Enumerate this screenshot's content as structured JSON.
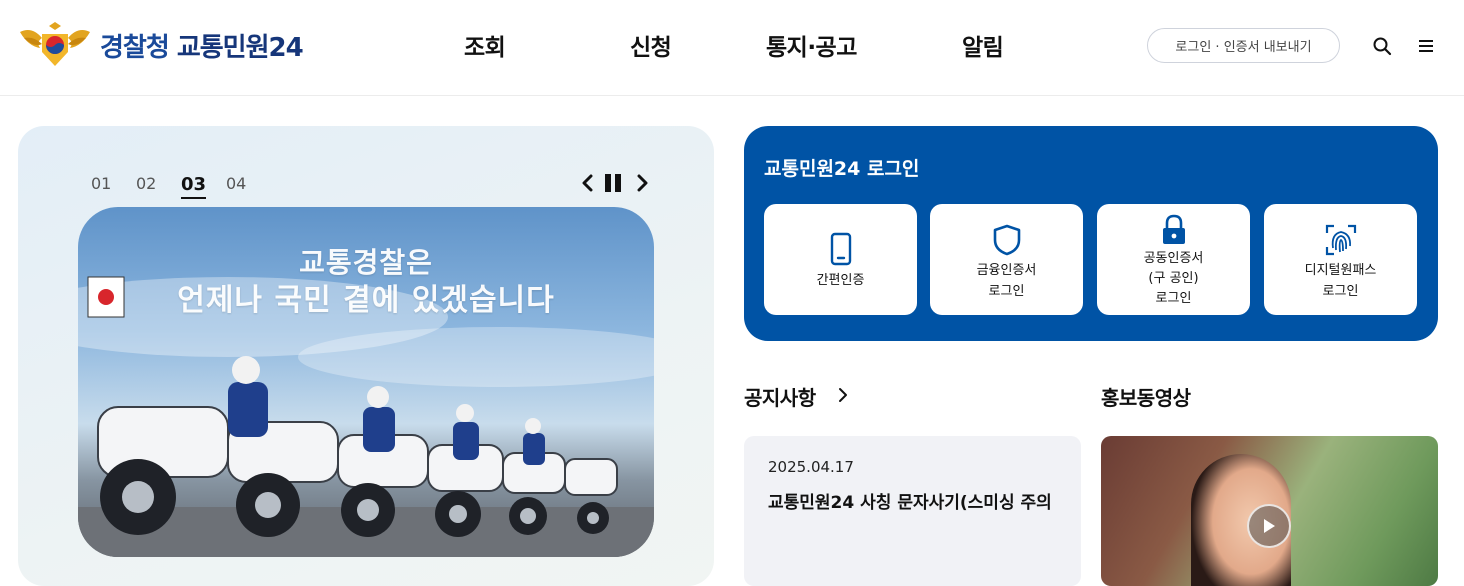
{
  "header": {
    "logo_text_1": "경찰청",
    "logo_text_2": "교통민원24",
    "nav": [
      "조회",
      "신청",
      "통지·공고",
      "알림"
    ],
    "login_export": "로그인 · 인증서 내보내기",
    "search_icon": "search-icon",
    "menu_icon": "hamburger-menu-icon"
  },
  "slider": {
    "tabs": [
      "01",
      "02",
      "03",
      "04"
    ],
    "active_tab": "03",
    "banner_line1": "교통경찰은",
    "banner_line2": "언제나 국민 곁에 있겠습니다"
  },
  "login": {
    "title": "교통민원24 로그인",
    "options": [
      {
        "label_lines": [
          "간편인증"
        ],
        "icon": "smartphone-icon"
      },
      {
        "label_lines": [
          "금융인증서",
          "로그인"
        ],
        "icon": "shield-icon"
      },
      {
        "label_lines": [
          "공동인증서",
          "(구 공인)",
          "로그인"
        ],
        "icon": "lock-icon"
      },
      {
        "label_lines": [
          "디지털원패스",
          "로그인"
        ],
        "icon": "fingerprint-icon"
      }
    ]
  },
  "notice": {
    "title": "공지사항",
    "items": [
      {
        "date": "2025.04.17",
        "text": "교통민원24 사칭 문자사기(스미싱 주의"
      }
    ]
  },
  "video": {
    "title": "홍보동영상"
  },
  "colors": {
    "brand_blue": "#0053a5",
    "logo_blue": "#1a4a9a",
    "notice_bg": "#f1f2f6"
  }
}
